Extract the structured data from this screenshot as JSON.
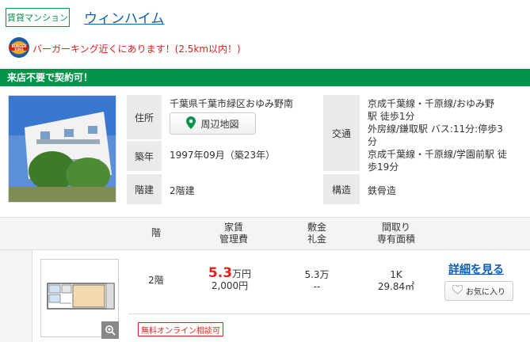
{
  "header": {
    "type_badge": "賃貸マンション",
    "title": "ウィンハイム",
    "promo_text": "バーガーキング近くにあります！(2.5km以内！)",
    "logo_text_top": "BURGER",
    "logo_text_bottom": "KING"
  },
  "banner": {
    "text": "来店不要で契約可！"
  },
  "info": {
    "address_label": "住所",
    "address_value": "千葉県千葉市緑区おゆみ野南",
    "map_button": "周辺地図",
    "built_label": "築年",
    "built_value": "1997年09月（築23年）",
    "floors_label": "階建",
    "floors_value": "2階建",
    "transport_label": "交通",
    "transport_lines": [
      "京成千葉線・千原線/おゆみ野",
      "駅 徒歩1分",
      "外房線/鎌取駅 バス:11分:停歩3",
      "分",
      "京成千葉線・千原線/学園前駅 徒",
      "歩19分"
    ],
    "structure_label": "構造",
    "structure_value": "鉄骨造"
  },
  "table": {
    "headers": {
      "floor": "階",
      "rent_1": "家賃",
      "rent_2": "管理費",
      "deposit_1": "敷金",
      "deposit_2": "礼金",
      "layout_1": "間取り",
      "layout_2": "専有面積"
    },
    "row": {
      "floor": "2階",
      "rent_num": "5.3",
      "rent_unit": "万円",
      "fee": "2,000円",
      "deposit": "5.3万",
      "key_money": "--",
      "layout": "1K",
      "area": "29.84㎡",
      "detail_link": "詳細を見る",
      "fav_button": "お気に入り",
      "online_badge": "無料オンライン相談可"
    }
  },
  "colors": {
    "accent_green": "#00934a",
    "link_blue": "#0a5fb4",
    "alert_red": "#e0201c"
  },
  "icons": [
    "burger-king-logo",
    "map-pin-icon",
    "heart-icon",
    "zoom-icon"
  ]
}
